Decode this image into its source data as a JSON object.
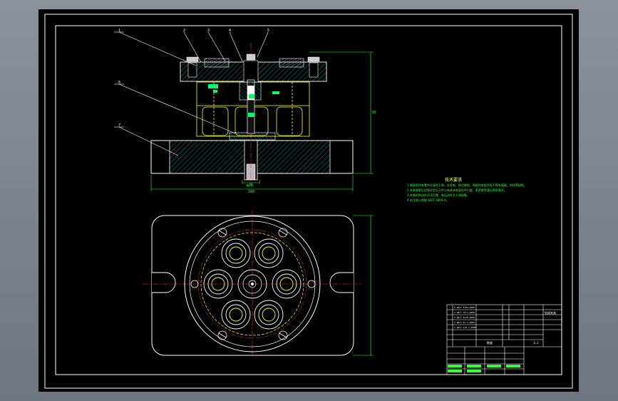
{
  "drawing": {
    "balloons": [
      "1",
      "2",
      "3",
      "4",
      "5",
      "6",
      "7"
    ],
    "dimension_labels": {
      "height": "95",
      "width": "180",
      "bore": "φ28"
    },
    "technical_requirements": {
      "title": "技术要求",
      "lines": [
        "1.装配前所有零件应清洗干净，去毛刺、锐边倒钝。装配时各配合面不得有磕碰、划伤等缺陷。",
        "2.夹具装配后应保证定位元件与夹具体底面的平行度、垂直度等满足图纸要求。",
        "3.夹紧机构动作灵活可靠，各运动件无卡滞现象。",
        "4.未注明公差按 GB/T 1804-m。"
      ]
    },
    "title_block": {
      "title": "钻床夹具",
      "rows": [
        "5 GB/T 5783-2000",
        "4 GB/T 70.1-2000",
        "3 GB/T 6170-2000",
        "2 GB/T 97.1-2002",
        "1 GB/T 119.1-2000"
      ],
      "qty_header": "数量",
      "scale": "1:1"
    },
    "colors": {
      "background": "#000000",
      "frame": "#ffffff",
      "outline": "#ffffff",
      "hatch": "#00ccff",
      "center_line": "#ff3333",
      "hidden_line": "#ffff00",
      "dimension": "#33ff33",
      "part_green": "#00ff66"
    }
  }
}
